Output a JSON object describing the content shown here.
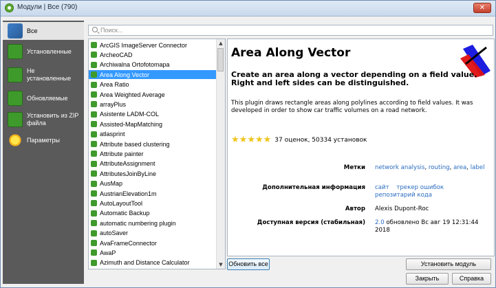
{
  "window": {
    "title": "Модули | Все (790)",
    "close_label": "✕"
  },
  "sidebar": {
    "items": [
      {
        "label": "Все",
        "icon": "all-plugins-icon"
      },
      {
        "label": "Установленные",
        "icon": "puzzle-icon"
      },
      {
        "label": "Не установленные",
        "icon": "puzzle-icon"
      },
      {
        "label": "Обновляемые",
        "icon": "puzzle-icon"
      },
      {
        "label": "Установить из ZIP файла",
        "icon": "puzzle-icon"
      },
      {
        "label": "Параметры",
        "icon": "gear-sun-icon"
      }
    ]
  },
  "search": {
    "placeholder": "Поиск..."
  },
  "plugins": [
    "ArcGIS ImageServer Connector",
    "ArcheoCAD",
    "Archiwalna Ortofotomapa",
    "Area Along Vector",
    "Area Ratio",
    "Area Weighted Average",
    "arrayPlus",
    "Asistente LADM-COL",
    "Assisted-MapMatching",
    "atlasprint",
    "Attribute based clustering",
    "Attribute painter",
    "AttributeAssignment",
    "AttributesJoinByLine",
    "AusMap",
    "AustrianElevation1m",
    "AutoLayoutTool",
    "Automatic Backup",
    "automatic numbering plugin",
    "autoSaver",
    "AvaFrameConnector",
    "AwaP",
    "Azimuth and Distance Calculator"
  ],
  "selected_plugin": "Area Along Vector",
  "detail": {
    "title": "Area Along Vector",
    "subtitle": "Create an area along a vector depending on a field value. Right and left sides can be distinguished.",
    "description": "This plugin draws rectangle areas along polylines according to field values. It was developed in order to show car traffic volumes on a road network.",
    "rating_stars": 4.5,
    "rating_text": "37 оценок, 50334 установок",
    "tags_label": "Метки",
    "tags": [
      {
        "text": "network analysis",
        "sep": ", "
      },
      {
        "text": "routing",
        "sep": ", "
      },
      {
        "text": "area",
        "sep": ", "
      },
      {
        "text": "label",
        "sep": ""
      }
    ],
    "more_info_label": "Дополнительная информация",
    "more_info_links": [
      "сайт",
      "трекер ошибок",
      "репозитарий кода"
    ],
    "author_label": "Автор",
    "author": "Alexis Dupont-Roc",
    "version_label": "Доступная версия (стабильная)",
    "version": "2.0",
    "version_date": "обновлено Вс авг 19 12:31:44 2018"
  },
  "buttons": {
    "upgrade_all": "Обновить все",
    "install": "Установить модуль",
    "close": "Закрыть",
    "help": "Справка"
  },
  "colors": {
    "selection": "#3399ff",
    "sidebar_bg": "#5a5a5a",
    "link": "#2a6cc2"
  }
}
